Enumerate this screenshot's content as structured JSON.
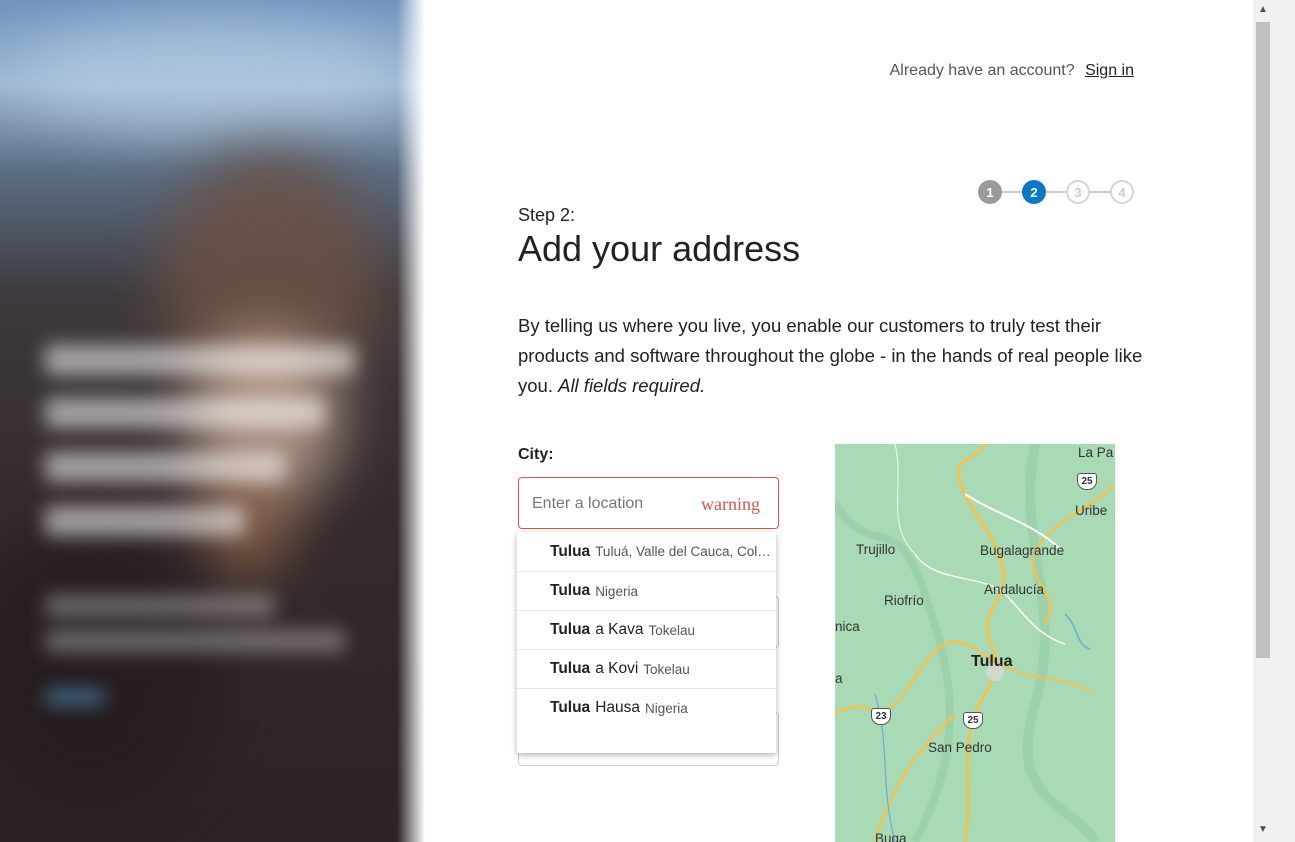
{
  "header": {
    "account_prompt": "Already have an account?",
    "signin_link": "Sign in"
  },
  "stepper": {
    "steps": [
      "1",
      "2",
      "3",
      "4"
    ],
    "current_step": 2
  },
  "step": {
    "label": "Step 2:",
    "title": "Add your address",
    "intro": "By telling us where you live, you enable our customers to truly test their products and software throughout the globe - in the hands of real people like you.",
    "intro_emphasis": "All fields required."
  },
  "city": {
    "label": "City:",
    "placeholder": "Enter a location",
    "value": "",
    "warning_text": "warning"
  },
  "autocomplete": {
    "items": [
      {
        "match": "Tulua",
        "rest": "",
        "secondary": "Tuluá, Valle del Cauca, Colombia"
      },
      {
        "match": "Tulua",
        "rest": "",
        "secondary": "Nigeria"
      },
      {
        "match": "Tulua",
        "rest": "a Kava",
        "secondary": "Tokelau"
      },
      {
        "match": "Tulua",
        "rest": "a Kovi",
        "secondary": "Tokelau"
      },
      {
        "match": "Tulua",
        "rest": "Hausa",
        "secondary": "Nigeria"
      }
    ]
  },
  "map": {
    "places": [
      "La Pa",
      "Uribe",
      "Trujillo",
      "Bugalagrande",
      "Andalucía",
      "Riofrío",
      "nica",
      "Tulua",
      "a",
      "San Pedro",
      "Buga"
    ],
    "route_shields": [
      "25",
      "23",
      "25"
    ]
  },
  "colors": {
    "accent": "#0a78c8",
    "error": "#d9534f",
    "map_land": "#a8dab5",
    "map_road": "#f6c14a"
  }
}
